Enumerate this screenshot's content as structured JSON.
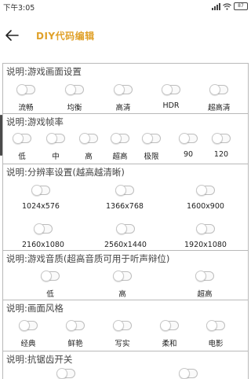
{
  "status_bar": {
    "time": "下午3:05",
    "battery": "87"
  },
  "header": {
    "title": "DIY代码编辑"
  },
  "sections": [
    {
      "title": "说明:游戏画面设置",
      "options": [
        "流畅",
        "均衡",
        "高清",
        "HDR",
        "超高清"
      ]
    },
    {
      "title": "说明:游戏帧率",
      "options": [
        "低",
        "中",
        "高",
        "超高",
        "极限",
        "90",
        "120"
      ]
    },
    {
      "title": "说明:分辨率设置(越高越清晰)",
      "options": [
        "1024x576",
        "1366x768",
        "1600x900",
        "2160x1080",
        "2560x1440",
        "1920x1080"
      ]
    },
    {
      "title": "说明:游戏音质(超高音质可用于听声辩位)",
      "options": [
        "低",
        "高",
        "超高"
      ]
    },
    {
      "title": "说明:画面风格",
      "options": [
        "经典",
        "鲜艳",
        "写实",
        "柔和",
        "电影"
      ]
    },
    {
      "title": "说明:抗锯齿开关",
      "options": []
    }
  ]
}
